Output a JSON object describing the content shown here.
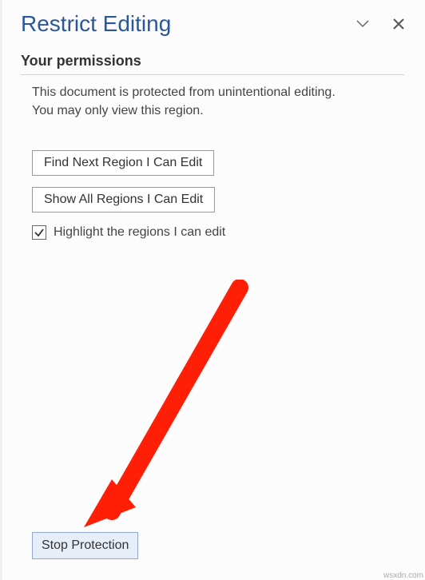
{
  "header": {
    "title": "Restrict Editing"
  },
  "section": {
    "heading": "Your permissions",
    "line1": "This document is protected from unintentional editing.",
    "line2": "You may only view this region."
  },
  "buttons": {
    "find_next": "Find Next Region I Can Edit",
    "show_all": "Show All Regions I Can Edit"
  },
  "checkbox": {
    "label": "Highlight the regions I can edit",
    "checked": true
  },
  "footer": {
    "stop_button": "Stop Protection"
  },
  "watermark": "wsxdn.com",
  "colors": {
    "accent": "#2b579a",
    "arrow": "#ff1e06"
  }
}
